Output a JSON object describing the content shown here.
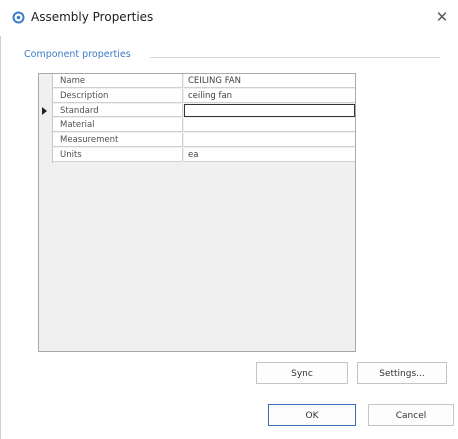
{
  "window": {
    "title": "Assembly Properties",
    "icon": "gear-icon",
    "close_icon": "close-icon",
    "close_glyph": "✕"
  },
  "group": {
    "label": "Component properties"
  },
  "properties": [
    {
      "name": "Name",
      "value": "CEILING FAN"
    },
    {
      "name": "Description",
      "value": "ceiling fan"
    },
    {
      "name": "Standard",
      "value": ""
    },
    {
      "name": "Material",
      "value": ""
    },
    {
      "name": "Measurement",
      "value": ""
    },
    {
      "name": "Units",
      "value": "ea"
    }
  ],
  "buttons": {
    "sync": "Sync",
    "settings": "Settings...",
    "ok": "OK",
    "cancel": "Cancel"
  },
  "colors": {
    "group_label": "#3b7cc9",
    "default_button_border": "#3a6fb5"
  }
}
